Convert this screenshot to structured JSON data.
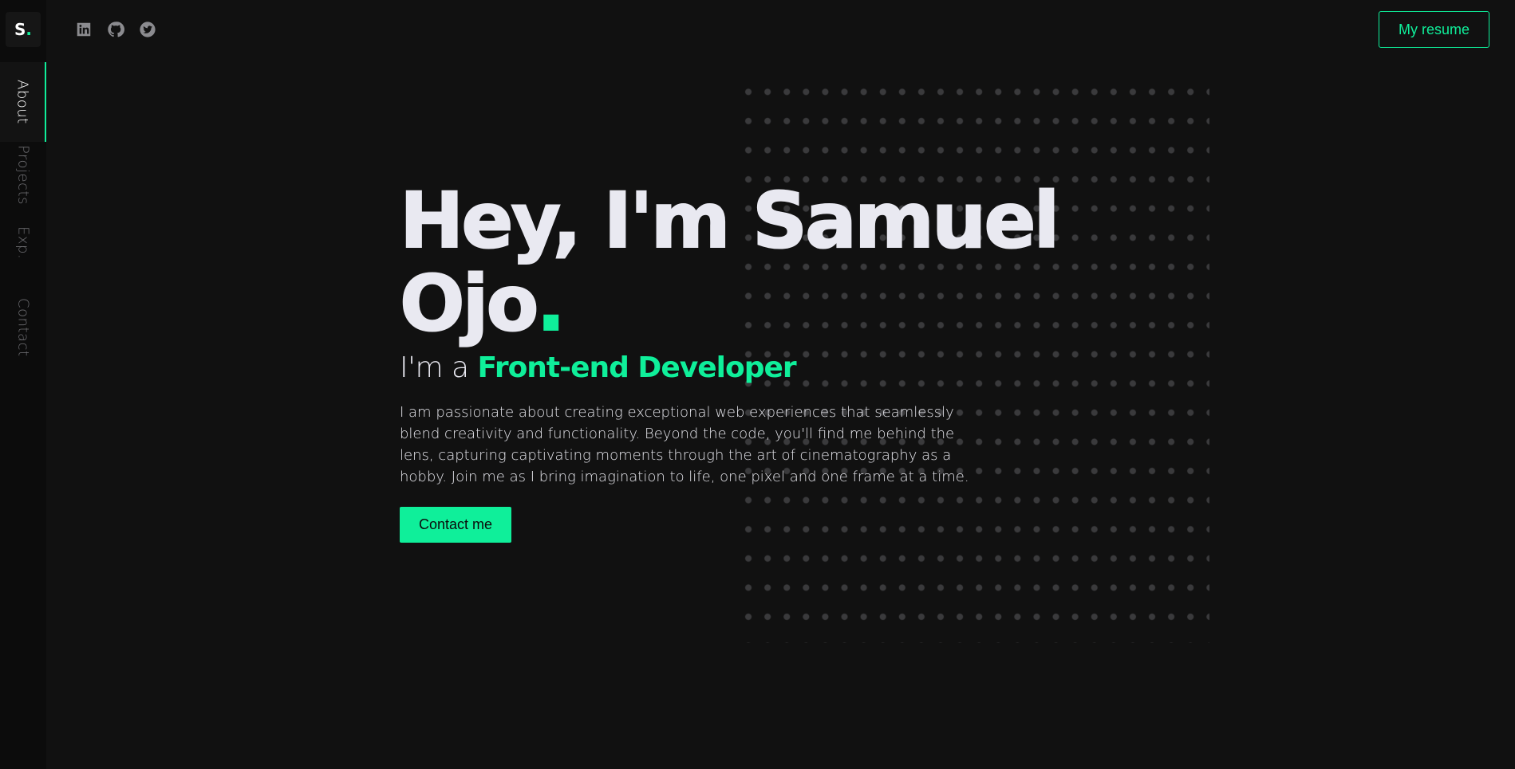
{
  "sidebar": {
    "logo": {
      "letter": "S",
      "dot": "."
    },
    "items": [
      {
        "label": "About",
        "active": true
      },
      {
        "label": "Projects",
        "active": false
      },
      {
        "label": "Exp.",
        "active": false
      },
      {
        "label": "Contact",
        "active": false
      }
    ]
  },
  "header": {
    "socials": [
      {
        "icon": "linkedin-icon"
      },
      {
        "icon": "github-icon"
      },
      {
        "icon": "twitter-icon"
      }
    ],
    "resume_label": "My resume"
  },
  "hero": {
    "title": "Hey, I'm Samuel Ojo",
    "title_dot": ".",
    "subtitle_prefix": "I'm a ",
    "role": "Front-end Developer",
    "bio": "I am passionate about creating exceptional web experiences that seamlessly blend creativity and functionality. Beyond the code, you'll find me behind the lens, capturing captivating moments through the art of cinematography as a hobby. Join me as I bring imagination to life, one pixel and one frame at a time.",
    "cta_label": "Contact me"
  },
  "colors": {
    "accent": "#0fef9a",
    "background": "#111111",
    "sidebar": "#0c0c0c",
    "text": "#e9e9f1"
  }
}
